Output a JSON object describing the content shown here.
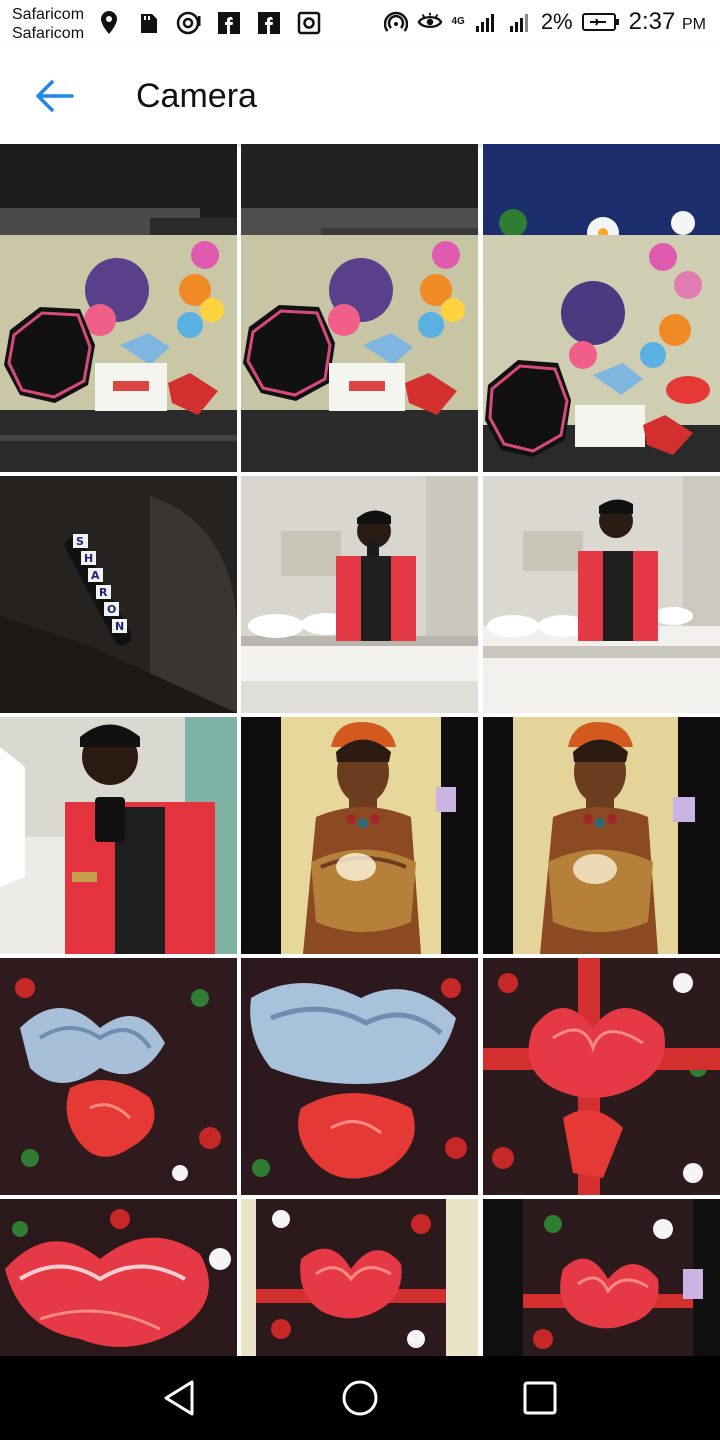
{
  "status_bar": {
    "carrier_line1": "Safaricom",
    "carrier_line2": "Safaricom",
    "network_label": "4G",
    "battery_percent": "2%",
    "time": "2:37",
    "time_suffix": "PM"
  },
  "app_bar": {
    "title": "Camera",
    "back_icon": "arrow-left-icon",
    "accent_color": "#1e88e5"
  },
  "gallery": {
    "columns": 3,
    "photos": [
      {
        "name": "mirror-office-photo"
      },
      {
        "name": "mirror-office-photo"
      },
      {
        "name": "holly-wrap-photo"
      },
      {
        "name": "stones-sign-flowers-photo"
      },
      {
        "name": "stones-sign-flowers-photo"
      },
      {
        "name": "stones-sign-flowers-photo"
      },
      {
        "name": "sharon-bracelet-photo"
      },
      {
        "name": "mirror-selfie-washroom-photo"
      },
      {
        "name": "mirror-selfie-washroom-photo"
      },
      {
        "name": "red-jacket-selfie-photo"
      },
      {
        "name": "african-woman-portrait-photo"
      },
      {
        "name": "african-woman-portrait-photo"
      },
      {
        "name": "blue-ribbon-gift-photo"
      },
      {
        "name": "blue-ribbon-gift-photo"
      },
      {
        "name": "red-bow-gift-photo"
      },
      {
        "name": "red-bow-gift-photo"
      },
      {
        "name": "red-bow-gift-photo"
      },
      {
        "name": "red-bow-gift-photo"
      }
    ],
    "bracelet_text": "SHARON"
  },
  "nav_bar": {
    "back_icon": "triangle-back-icon",
    "home_icon": "circle-home-icon",
    "recents_icon": "square-recents-icon"
  }
}
